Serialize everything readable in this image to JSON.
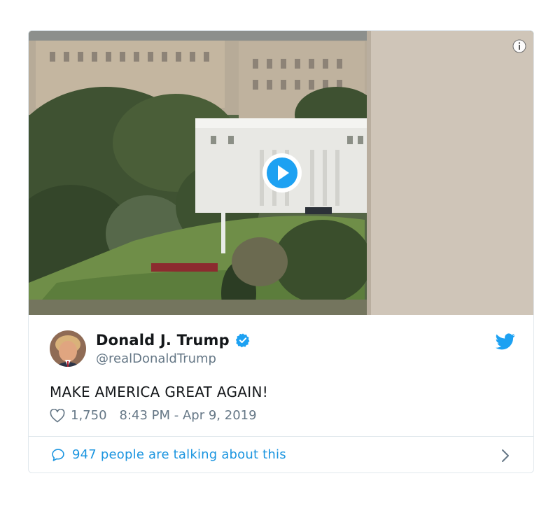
{
  "tweet": {
    "display_name": "Donald J. Trump",
    "handle": "@realDonaldTrump",
    "text": "MAKE AMERICA GREAT AGAIN!",
    "like_count": "1,750",
    "timestamp": "8:43 PM - Apr 9, 2019",
    "talking_label": "947 people are talking about this"
  },
  "icons": {
    "info": "info-icon",
    "play": "play-icon",
    "verified": "verified-badge-icon",
    "brand": "twitter-bird-icon",
    "like": "heart-icon",
    "reply": "speech-bubble-icon",
    "more": "chevron-right-icon"
  },
  "colors": {
    "accent": "#1da1f2",
    "link": "#1b95e0",
    "muted": "#657786",
    "border": "#e1e8ed"
  }
}
